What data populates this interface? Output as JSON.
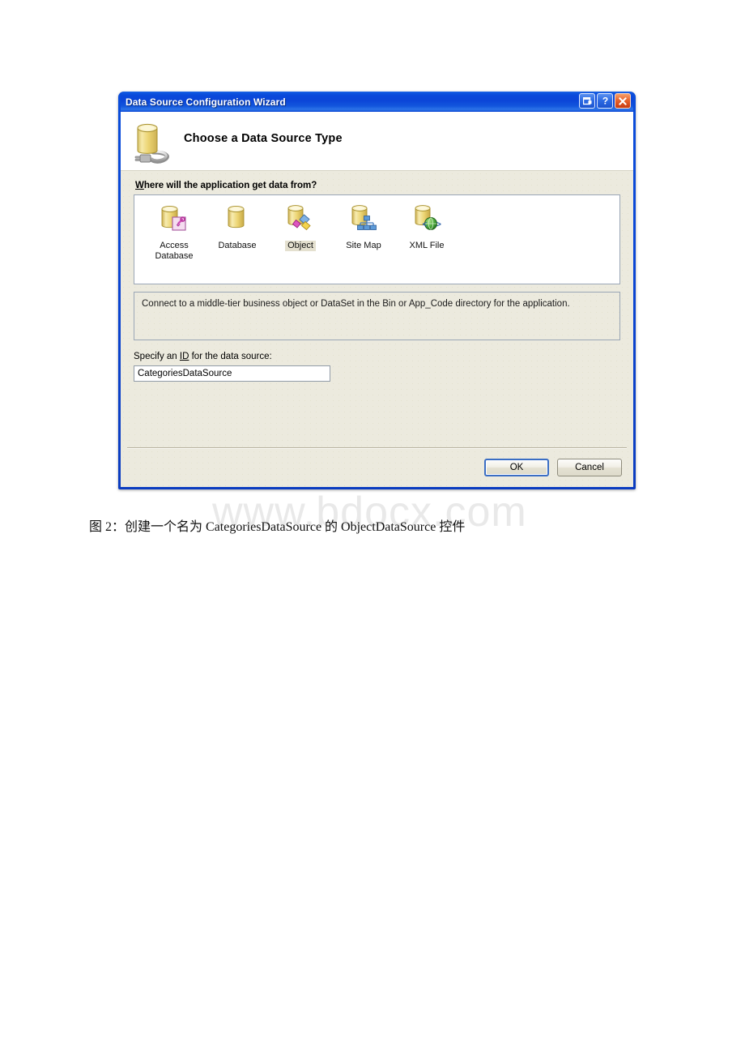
{
  "dialog": {
    "title": "Data Source Configuration Wizard",
    "header_title": "Choose a Data Source Type",
    "header_icon": "database-plug-icon",
    "title_buttons": [
      {
        "name": "restore-button",
        "label": "Restore"
      },
      {
        "name": "help-button",
        "label": "?"
      },
      {
        "name": "close-button",
        "label": "X"
      }
    ],
    "section_label_prefix": "W",
    "section_label_rest": "here will the application get data from?",
    "data_sources": [
      {
        "label_line1": "Access",
        "label_line2": "Database",
        "icon": "access-database-icon",
        "selected": false
      },
      {
        "label_line1": "Database",
        "label_line2": "",
        "icon": "database-icon",
        "selected": false
      },
      {
        "label_line1": "Object",
        "label_line2": "",
        "icon": "object-icon",
        "selected": true
      },
      {
        "label_line1": "Site Map",
        "label_line2": "",
        "icon": "site-map-icon",
        "selected": false
      },
      {
        "label_line1": "XML File",
        "label_line2": "",
        "icon": "xml-file-icon",
        "selected": false
      }
    ],
    "description": "Connect to a middle-tier business object or DataSet in the Bin or App_Code directory for the application.",
    "id_label_prefix": "Specify an ",
    "id_label_accel": "ID",
    "id_label_suffix": " for the data source:",
    "id_value": "CategoriesDataSource",
    "buttons": {
      "ok": "OK",
      "cancel": "Cancel"
    },
    "colors": {
      "titlebar_blue": "#0a46d6",
      "body_beige": "#eceade",
      "close_red": "#e8642c",
      "selected_highlight": "#e4e0cf",
      "default_button_border": "#3b6ec4"
    }
  },
  "page": {
    "watermark": "www.bdocx.com",
    "caption": "图 2：创建一个名为 CategoriesDataSource 的 ObjectDataSource 控件"
  }
}
